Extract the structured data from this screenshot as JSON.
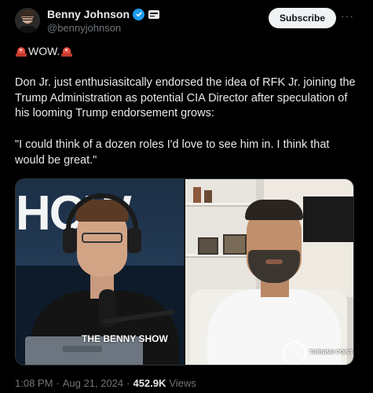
{
  "author": {
    "display_name": "Benny Johnson",
    "handle": "@bennyjohnson",
    "verified_icon": "verified-badge-icon",
    "affiliate_icon": "affiliate-badge-icon"
  },
  "actions": {
    "subscribe_label": "Subscribe",
    "more_icon": "more-icon"
  },
  "post": {
    "wow_text": "WOW.",
    "body": "Don Jr. just enthusiasitcally endorsed the idea of RFK Jr. joining the Trump Administration as potential CIA Director after speculation of his looming Trump endorsement grows:",
    "quote": "\"I could think of a dozen roles I'd love to see him in. I think that would be great.\""
  },
  "media": {
    "left_logo": "HOW",
    "watermark_benny": "THE BENNY SHOW",
    "watermark_tp": "TURNING POINT"
  },
  "meta": {
    "time": "1:08 PM",
    "separator": "·",
    "date": "Aug 21, 2024",
    "views_count": "452.9K",
    "views_label": "Views"
  },
  "colors": {
    "background": "#000000",
    "text": "#e7e9ea",
    "muted": "#71767b",
    "verified": "#1d9bf0",
    "button_bg": "#eff3f4"
  }
}
